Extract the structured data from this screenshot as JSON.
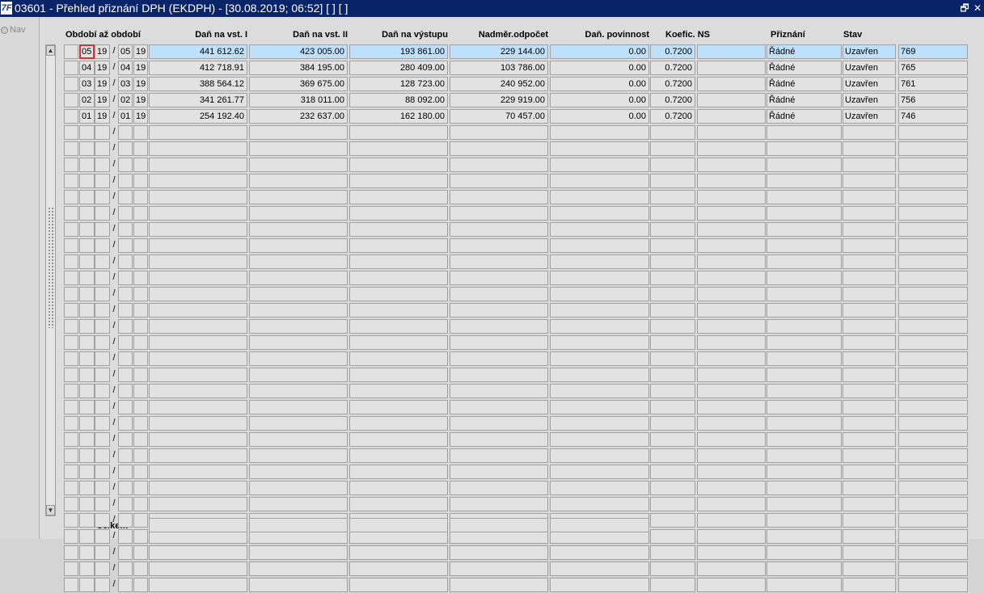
{
  "window": {
    "icon_text": "7F",
    "title": "03601 - Přehled přiznání DPH (EKDPH) - [30.08.2019; 06:52]  [ ]  [ ]",
    "restore_glyph": "🗗",
    "close_glyph": "✕"
  },
  "nav": {
    "label": "Nav"
  },
  "headers": {
    "period": "Období až období",
    "dan_vst_1": "Daň na vst. I",
    "dan_vst_2": "Daň na vst. II",
    "dan_vystup": "Daň na výstupu",
    "nadmer": "Nadměr.odpočet",
    "povinnost": "Daň. povinnost",
    "koefic": "Koefic. NS",
    "priznani": "Přiznání",
    "stav": "Stav"
  },
  "scrollbar": {
    "up_glyph": "▲",
    "down_glyph": "▼"
  },
  "rows": [
    {
      "from_m": "05",
      "from_y": "19",
      "sep": "/",
      "to_m": "05",
      "to_y": "19",
      "dan_vst_1": "441 612.62",
      "dan_vst_2": "423 005.00",
      "dan_vystup": "193 861.00",
      "nadmer": "229 144.00",
      "povinnost": "0.00",
      "koefic": "0.7200",
      "ns": "",
      "priznani": "Řádné",
      "stav": "Uzavřen",
      "id": "769"
    },
    {
      "from_m": "04",
      "from_y": "19",
      "sep": "/",
      "to_m": "04",
      "to_y": "19",
      "dan_vst_1": "412 718.91",
      "dan_vst_2": "384 195.00",
      "dan_vystup": "280 409.00",
      "nadmer": "103 786.00",
      "povinnost": "0.00",
      "koefic": "0.7200",
      "ns": "",
      "priznani": "Řádné",
      "stav": "Uzavřen",
      "id": "765"
    },
    {
      "from_m": "03",
      "from_y": "19",
      "sep": "/",
      "to_m": "03",
      "to_y": "19",
      "dan_vst_1": "388 564.12",
      "dan_vst_2": "369 675.00",
      "dan_vystup": "128 723.00",
      "nadmer": "240 952.00",
      "povinnost": "0.00",
      "koefic": "0.7200",
      "ns": "",
      "priznani": "Řádné",
      "stav": "Uzavřen",
      "id": "761"
    },
    {
      "from_m": "02",
      "from_y": "19",
      "sep": "/",
      "to_m": "02",
      "to_y": "19",
      "dan_vst_1": "341 261.77",
      "dan_vst_2": "318 011.00",
      "dan_vystup": "88 092.00",
      "nadmer": "229 919.00",
      "povinnost": "0.00",
      "koefic": "0.7200",
      "ns": "",
      "priznani": "Řádné",
      "stav": "Uzavřen",
      "id": "756"
    },
    {
      "from_m": "01",
      "from_y": "19",
      "sep": "/",
      "to_m": "01",
      "to_y": "19",
      "dan_vst_1": "254 192.40",
      "dan_vst_2": "232 637.00",
      "dan_vystup": "162 180.00",
      "nadmer": "70 457.00",
      "povinnost": "0.00",
      "koefic": "0.7200",
      "ns": "",
      "priznani": "Řádné",
      "stav": "Uzavřen",
      "id": "746"
    },
    {
      "sep": "/"
    },
    {
      "sep": "/"
    },
    {
      "sep": "/"
    },
    {
      "sep": "/"
    },
    {
      "sep": "/"
    },
    {
      "sep": "/"
    },
    {
      "sep": "/"
    },
    {
      "sep": "/"
    },
    {
      "sep": "/"
    },
    {
      "sep": "/"
    },
    {
      "sep": "/"
    },
    {
      "sep": "/"
    },
    {
      "sep": "/"
    },
    {
      "sep": "/"
    },
    {
      "sep": "/"
    },
    {
      "sep": "/"
    },
    {
      "sep": "/"
    },
    {
      "sep": "/"
    },
    {
      "sep": "/"
    },
    {
      "sep": "/"
    },
    {
      "sep": "/"
    },
    {
      "sep": "/"
    },
    {
      "sep": "/"
    },
    {
      "sep": "/"
    },
    {
      "sep": "/"
    },
    {
      "sep": "/"
    },
    {
      "sep": "/"
    },
    {
      "sep": "/"
    },
    {
      "sep": "/"
    }
  ],
  "totals": {
    "label": "Celkem",
    "dan_vst_1": "",
    "dan_vst_2": "",
    "dan_vystup": "",
    "nadmer": "",
    "povinnost": ""
  }
}
